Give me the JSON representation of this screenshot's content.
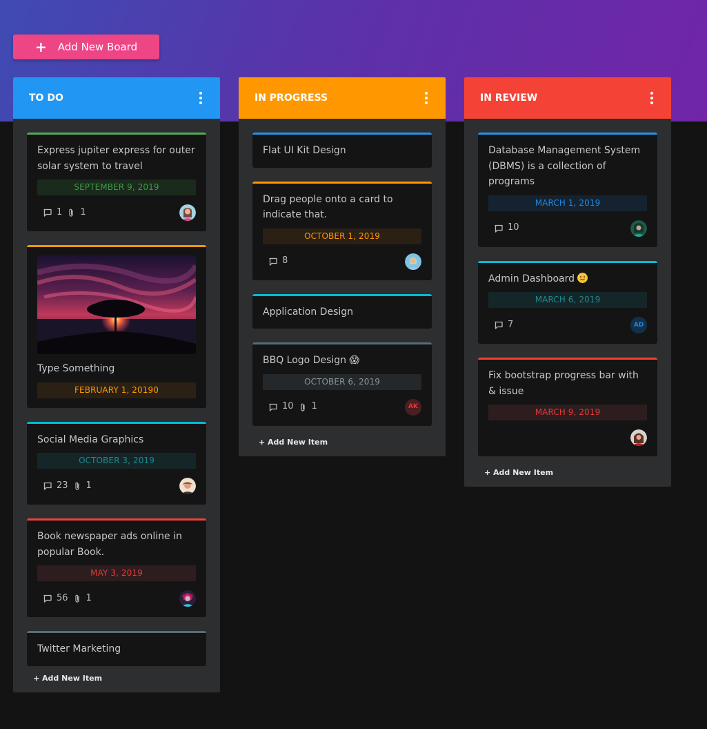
{
  "header": {
    "add_board_label": "Add New Board"
  },
  "colors": {
    "todo": "#2196f3",
    "in_progress": "#ff9800",
    "in_review": "#f44336",
    "add_board": "#ee4684"
  },
  "columns": [
    {
      "title": "TO DO",
      "add_item_label": "+ Add New Item",
      "cards": [
        {
          "title": "Express jupiter express for outer solar system to travel",
          "date": "SEPTEMBER 9, 2019",
          "comments": "1",
          "attachments": "1"
        },
        {
          "title": "Type Something",
          "date": "FEBRUARY 1, 20190"
        },
        {
          "title": "Social Media Graphics",
          "date": "OCTOBER 3, 2019",
          "comments": "23",
          "attachments": "1"
        },
        {
          "title": "Book newspaper ads online in popular Book.",
          "date": "MAY 3, 2019",
          "comments": "56",
          "attachments": "1"
        },
        {
          "title": "Twitter Marketing"
        }
      ]
    },
    {
      "title": "IN PROGRESS",
      "add_item_label": "+ Add New Item",
      "cards": [
        {
          "title": "Flat UI Kit Design"
        },
        {
          "title": "Drag people onto a card to indicate that.",
          "date": "OCTOBER 1, 2019",
          "comments": "8"
        },
        {
          "title": "Application Design"
        },
        {
          "title": "BBQ Logo Design 😱",
          "date": "OCTOBER 6, 2019",
          "comments": "10",
          "attachments": "1",
          "avatar_initials": "AK"
        }
      ]
    },
    {
      "title": "IN REVIEW",
      "add_item_label": "+ Add New Item",
      "cards": [
        {
          "title": "Database Management System (DBMS) is a collection of programs",
          "date": "MARCH 1, 2019",
          "comments": "10"
        },
        {
          "title": "Admin Dashboard",
          "date": "MARCH 6, 2019",
          "comments": "7",
          "avatar_initials": "AD"
        },
        {
          "title": "Fix bootstrap progress bar with & issue",
          "date": "MARCH 9, 2019"
        }
      ]
    }
  ]
}
